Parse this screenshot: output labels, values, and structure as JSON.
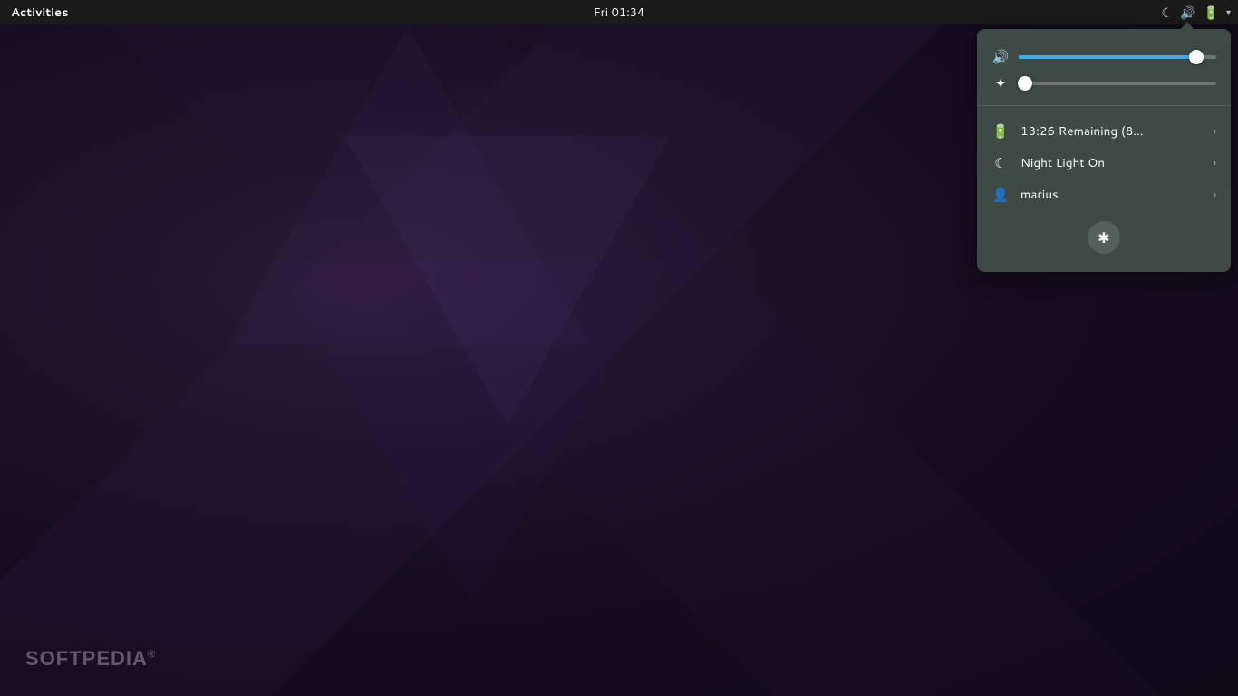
{
  "topbar": {
    "activities_label": "Activities",
    "datetime": "Fri 01:34",
    "arrow_char": "▾"
  },
  "icons": {
    "night_light": "☾",
    "volume": "🔊",
    "battery": "🔋",
    "brightness": "✦",
    "battery_menu": "🔋",
    "user": "👤",
    "settings": "✱",
    "chevron_right": "›"
  },
  "system_menu": {
    "volume_percent": 90,
    "brightness_percent": 3,
    "battery_label": "13:26 Remaining (8...",
    "night_light_label": "Night Light On",
    "user_label": "marius",
    "settings_tooltip": "Settings"
  },
  "desktop": {
    "watermark": "SOFTPEDIA",
    "watermark_sup": "®"
  }
}
